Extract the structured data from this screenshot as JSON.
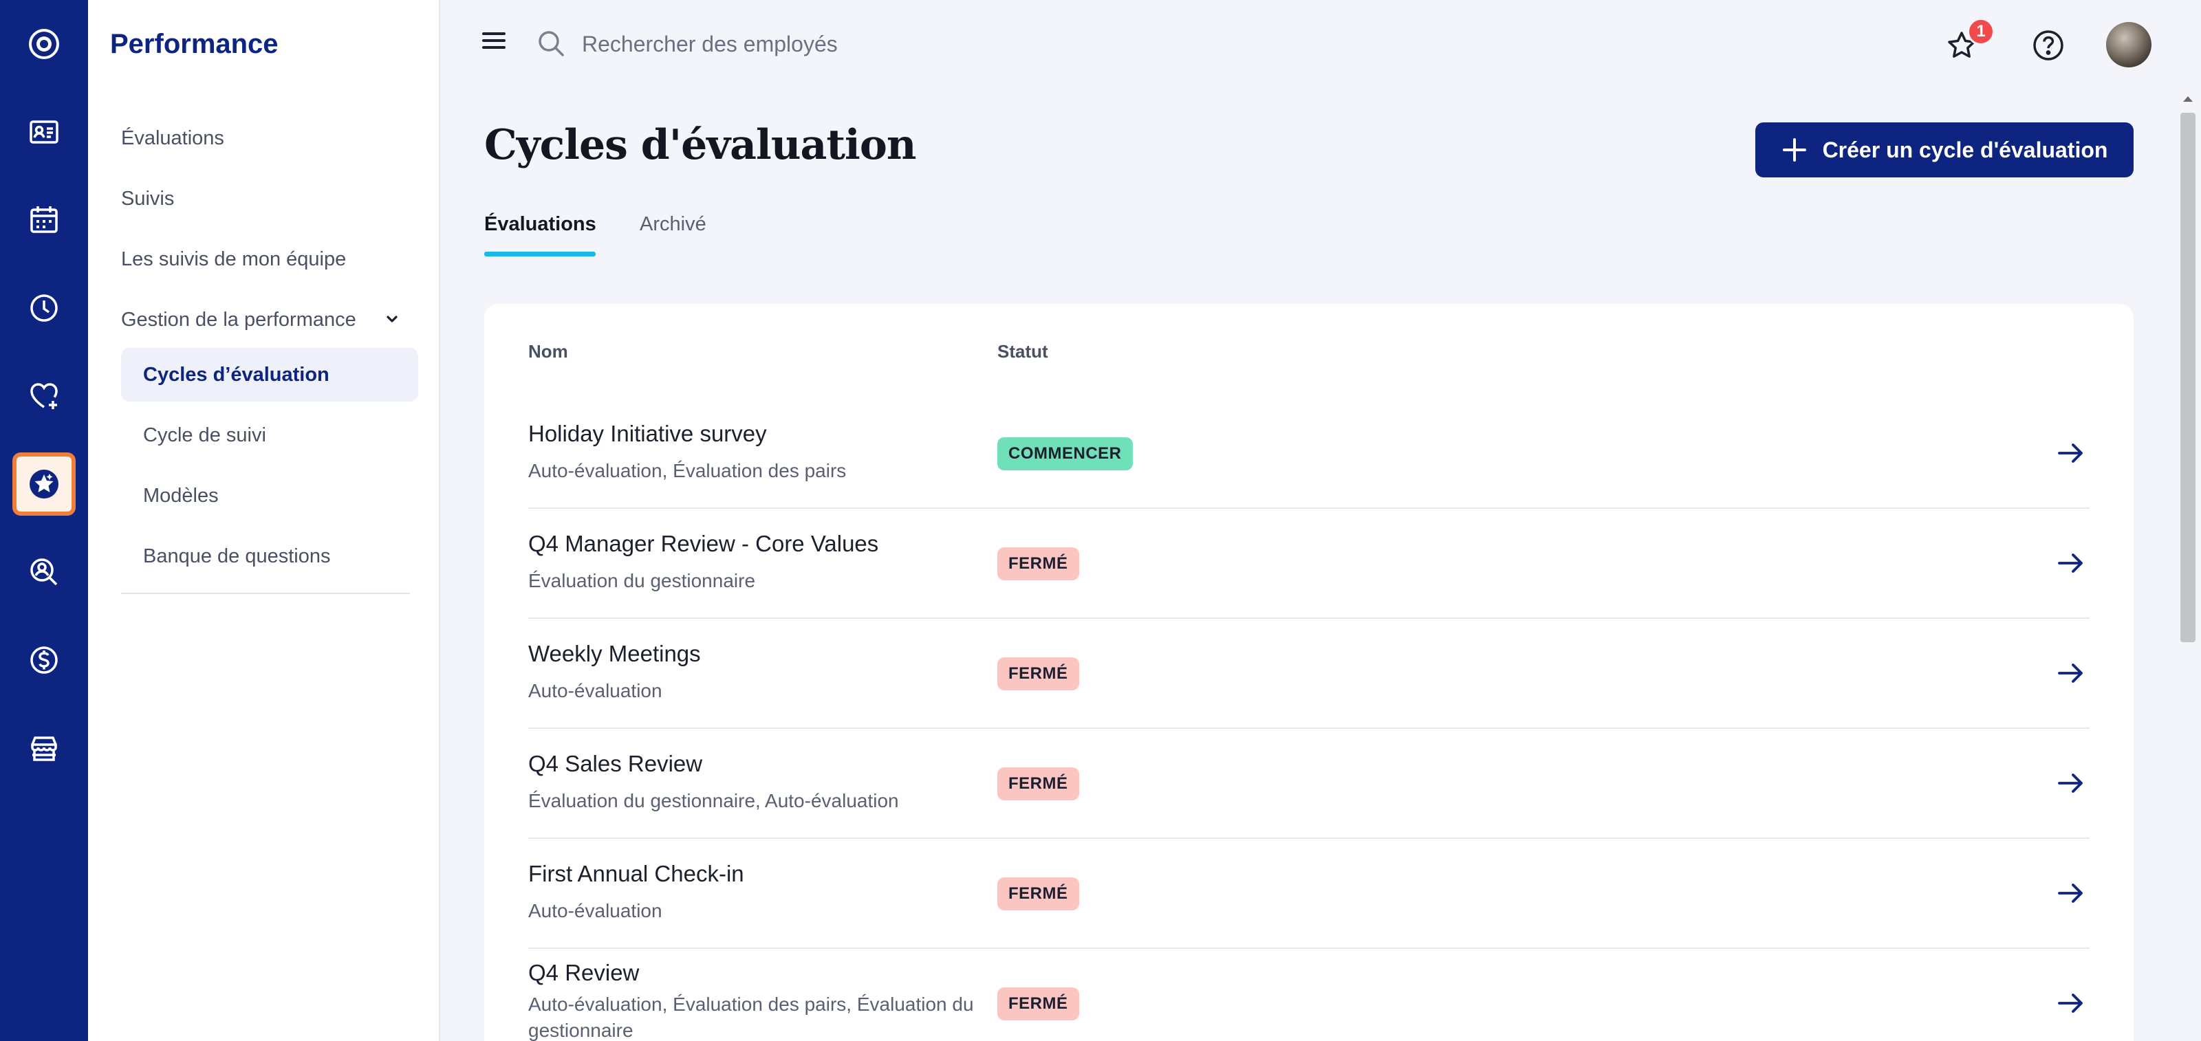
{
  "sidebar": {
    "title": "Performance",
    "items": [
      {
        "label": "Évaluations"
      },
      {
        "label": "Suivis"
      },
      {
        "label": "Les suivis de mon équipe"
      },
      {
        "label": "Gestion de la performance"
      }
    ],
    "subitems": [
      {
        "label": "Cycles d’évaluation",
        "selected": true
      },
      {
        "label": "Cycle de suivi"
      },
      {
        "label": "Modèles"
      },
      {
        "label": "Banque de questions"
      }
    ]
  },
  "rail": {
    "icons": [
      "app-logo-icon",
      "employee-card-icon",
      "calendar-icon",
      "clock-icon",
      "heart-plus-icon",
      "star-performance-icon",
      "user-search-icon",
      "dollar-icon",
      "store-icon"
    ],
    "active_index": 5
  },
  "topbar": {
    "search_placeholder": "Rechercher des employés",
    "notification_count": "1"
  },
  "page": {
    "title": "Cycles d'évaluation",
    "create_button": "Créer un cycle d'évaluation",
    "tabs": [
      {
        "label": "Évaluations",
        "active": true
      },
      {
        "label": "Archivé",
        "active": false
      }
    ]
  },
  "table": {
    "headers": {
      "name": "Nom",
      "status": "Statut"
    },
    "rows": [
      {
        "name": "Holiday Initiative survey",
        "types": "Auto-évaluation, Évaluation des pairs",
        "status": "COMMENCER",
        "status_color": "#6fe0b8"
      },
      {
        "name": "Q4 Manager Review - Core Values",
        "types": "Évaluation du gestionnaire",
        "status": "FERMÉ",
        "status_color": "#fbc5c2"
      },
      {
        "name": "Weekly Meetings",
        "types": "Auto-évaluation",
        "status": "FERMÉ",
        "status_color": "#fbc5c2"
      },
      {
        "name": "Q4 Sales Review",
        "types": "Évaluation du gestionnaire, Auto-évaluation",
        "status": "FERMÉ",
        "status_color": "#fbc5c2"
      },
      {
        "name": "First Annual Check-in",
        "types": "Auto-évaluation",
        "status": "FERMÉ",
        "status_color": "#fbc5c2"
      },
      {
        "name": "Q4 Review",
        "types": "Auto-évaluation, Évaluation des pairs, Évaluation du gestionnaire",
        "status": "FERMÉ",
        "status_color": "#fbc5c2"
      }
    ]
  },
  "colors": {
    "brand": "#0d2580",
    "accent_tab": "#18b8e8",
    "active_rail_border": "#f07f3c"
  }
}
